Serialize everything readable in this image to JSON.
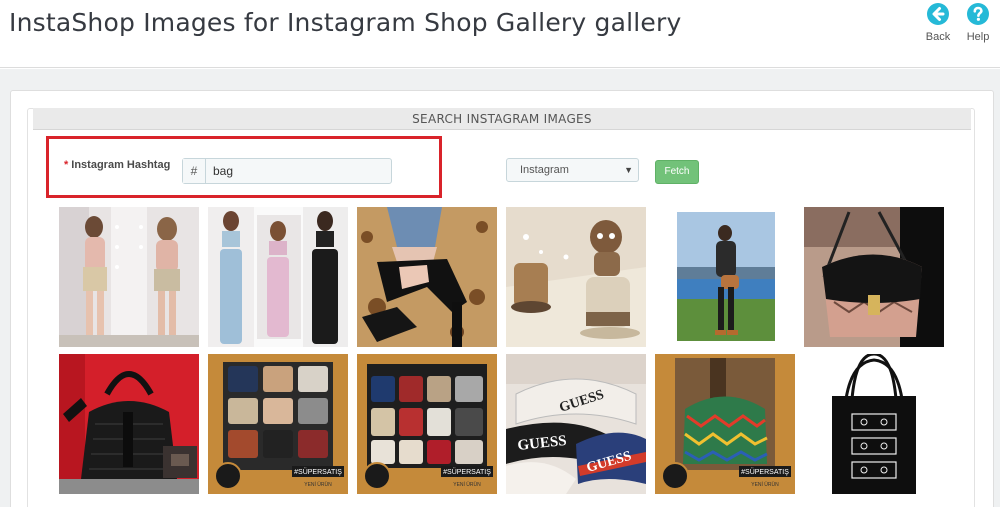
{
  "header": {
    "title": "InstaShop Images for Instagram Shop Gallery gallery",
    "back_label": "Back",
    "help_label": "Help",
    "accent": "#25b9d7"
  },
  "search": {
    "section_title": "SEARCH INSTAGRAM IMAGES",
    "hashtag_label": "Instagram Hashtag",
    "required_mark": "*",
    "hashtag_prefix": "#",
    "hashtag_value": "bag",
    "source_selected": "Instagram",
    "fetch_label": "Fetch"
  },
  "images": [
    {
      "name": "image-two-women-posing"
    },
    {
      "name": "image-three-women-outfits"
    },
    {
      "name": "image-black-heels"
    },
    {
      "name": "image-doll-boots"
    },
    {
      "name": "image-woman-beach-bag"
    },
    {
      "name": "image-snakeskin-bag"
    },
    {
      "name": "image-black-handbag"
    },
    {
      "name": "image-bags-shelf-1",
      "badge": "#SÜPERSATIŞ",
      "sub": "YENİ ÜRÜN"
    },
    {
      "name": "image-bags-shelf-2",
      "badge": "#SÜPERSATIŞ",
      "sub": "YENİ ÜRÜN"
    },
    {
      "name": "image-guess-belt-bags",
      "brand1": "GUESS",
      "brand2": "GUESS",
      "brand3": "GUESS"
    },
    {
      "name": "image-patterned-bag",
      "badge": "#SÜPERSATIŞ",
      "sub": "YENİ ÜRÜN"
    },
    {
      "name": "image-black-tote"
    }
  ]
}
